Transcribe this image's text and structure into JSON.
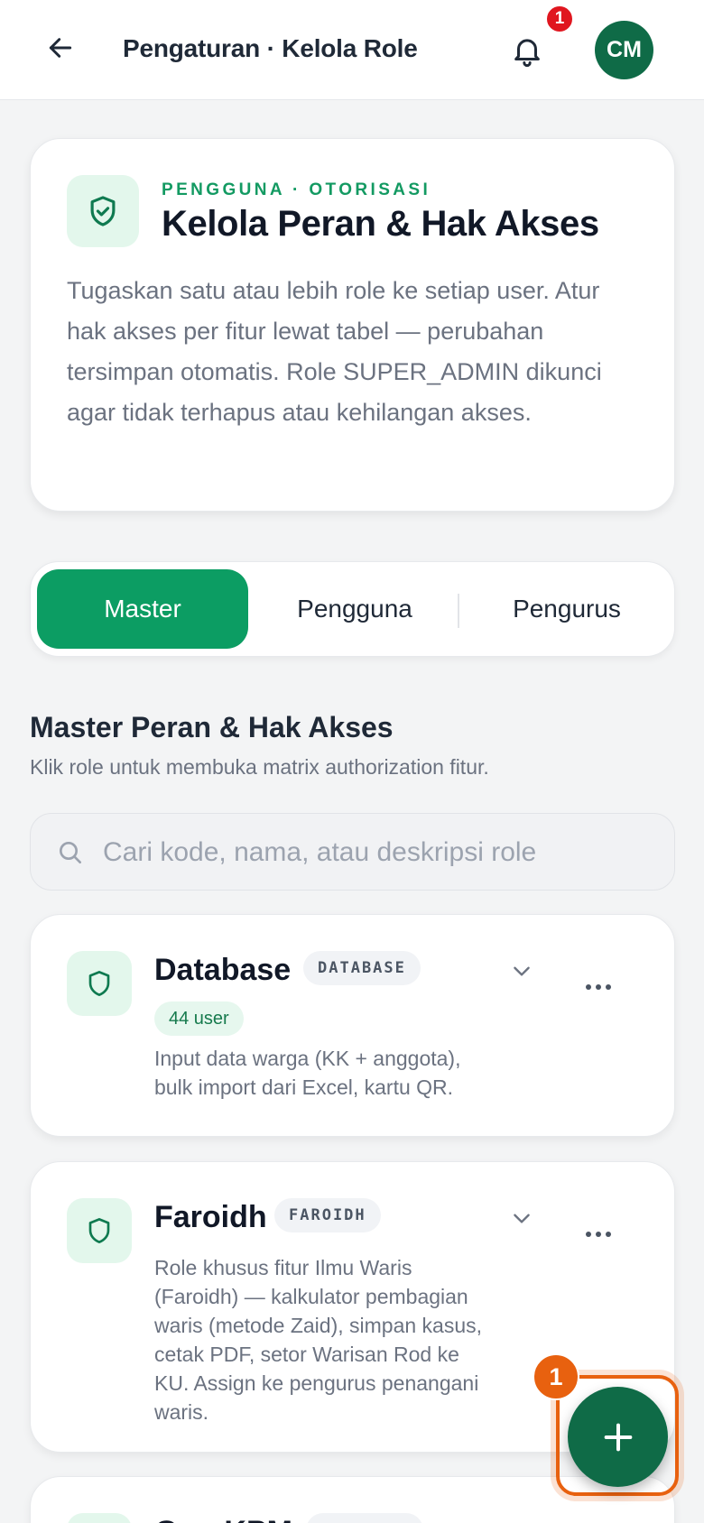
{
  "header": {
    "title": "Pengaturan · Kelola Role",
    "notification_count": "1",
    "avatar_initials": "CM"
  },
  "intro": {
    "eyebrow": "PENGGUNA · OTORISASI",
    "title": "Kelola Peran & Hak Akses",
    "description": "Tugaskan satu atau lebih role ke setiap user. Atur hak akses per fitur lewat tabel — perubahan tersimpan otomatis. Role SUPER_ADMIN dikunci agar tidak terhapus atau kehilangan akses."
  },
  "tabs": [
    {
      "label": "Master",
      "active": true
    },
    {
      "label": "Pengguna",
      "active": false
    },
    {
      "label": "Pengurus",
      "active": false
    }
  ],
  "section": {
    "title": "Master Peran & Hak Akses",
    "subtitle": "Klik role untuk membuka matrix authorization fitur."
  },
  "search": {
    "placeholder": "Cari kode, nama, atau deskripsi role",
    "value": ""
  },
  "roles": [
    {
      "name": "Database",
      "code": "DATABASE",
      "users": "44 user",
      "description": "Input data warga (KK + anggota), bulk import dari Excel, kartu QR."
    },
    {
      "name": "Faroidh",
      "code": "FAROIDH",
      "description": "Role khusus fitur Ilmu Waris (Faroidh) — kalkulator pembagian waris (metode Zaid), simpan kasus, cetak PDF, setor Warisan Rod ke KU. Assign ke pengurus penangani waris."
    },
    {
      "name": "Gun KPM",
      "code": "GUNA_KPM"
    }
  ],
  "fab": {
    "step_badge": "1"
  },
  "colors": {
    "primary": "#0c9d63",
    "primary_dark": "#0f6b47",
    "accent_orange": "#e8610f",
    "notification_red": "#e0161f"
  },
  "icons": [
    "back-arrow-icon",
    "bell-icon",
    "shield-check-icon",
    "shield-icon",
    "search-icon",
    "chevron-down-icon",
    "more-horizontal-icon",
    "plus-icon"
  ]
}
